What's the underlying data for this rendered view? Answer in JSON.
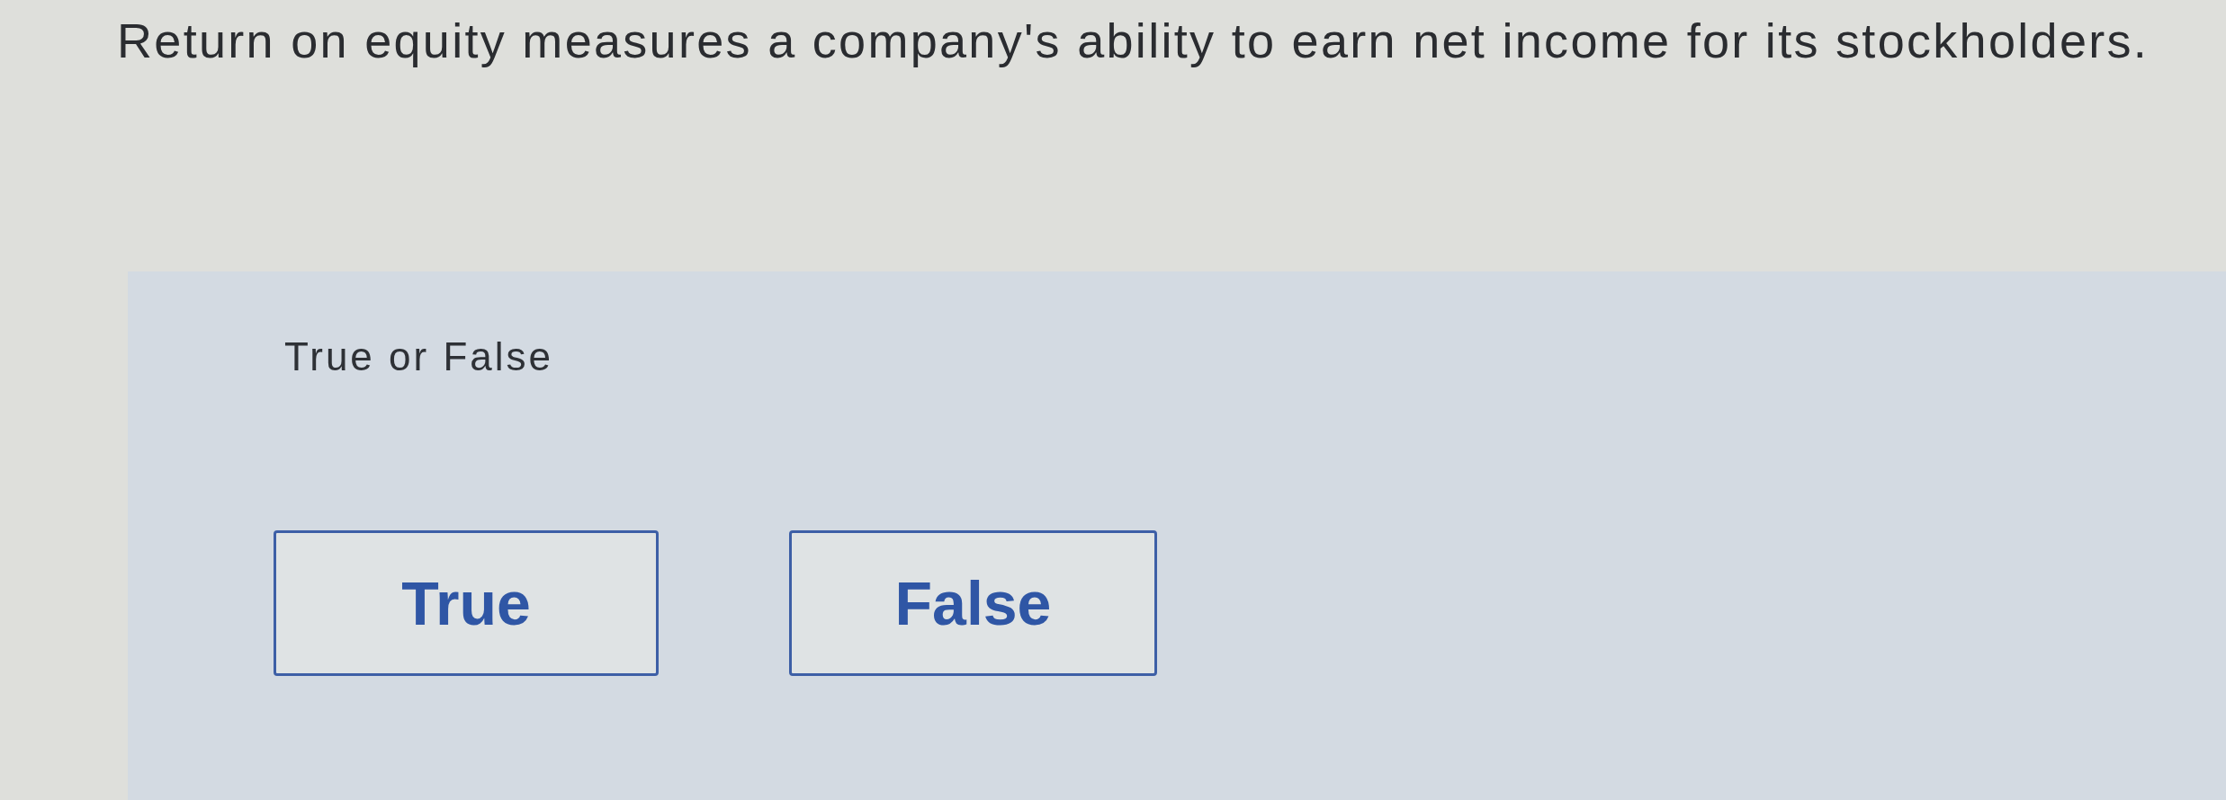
{
  "question": {
    "text": "Return on equity measures a company's ability to earn net income for its stockholders."
  },
  "answer_panel": {
    "prompt": "True or False",
    "options": [
      {
        "label": "True",
        "selected": false
      },
      {
        "label": "False",
        "selected": false
      }
    ]
  }
}
